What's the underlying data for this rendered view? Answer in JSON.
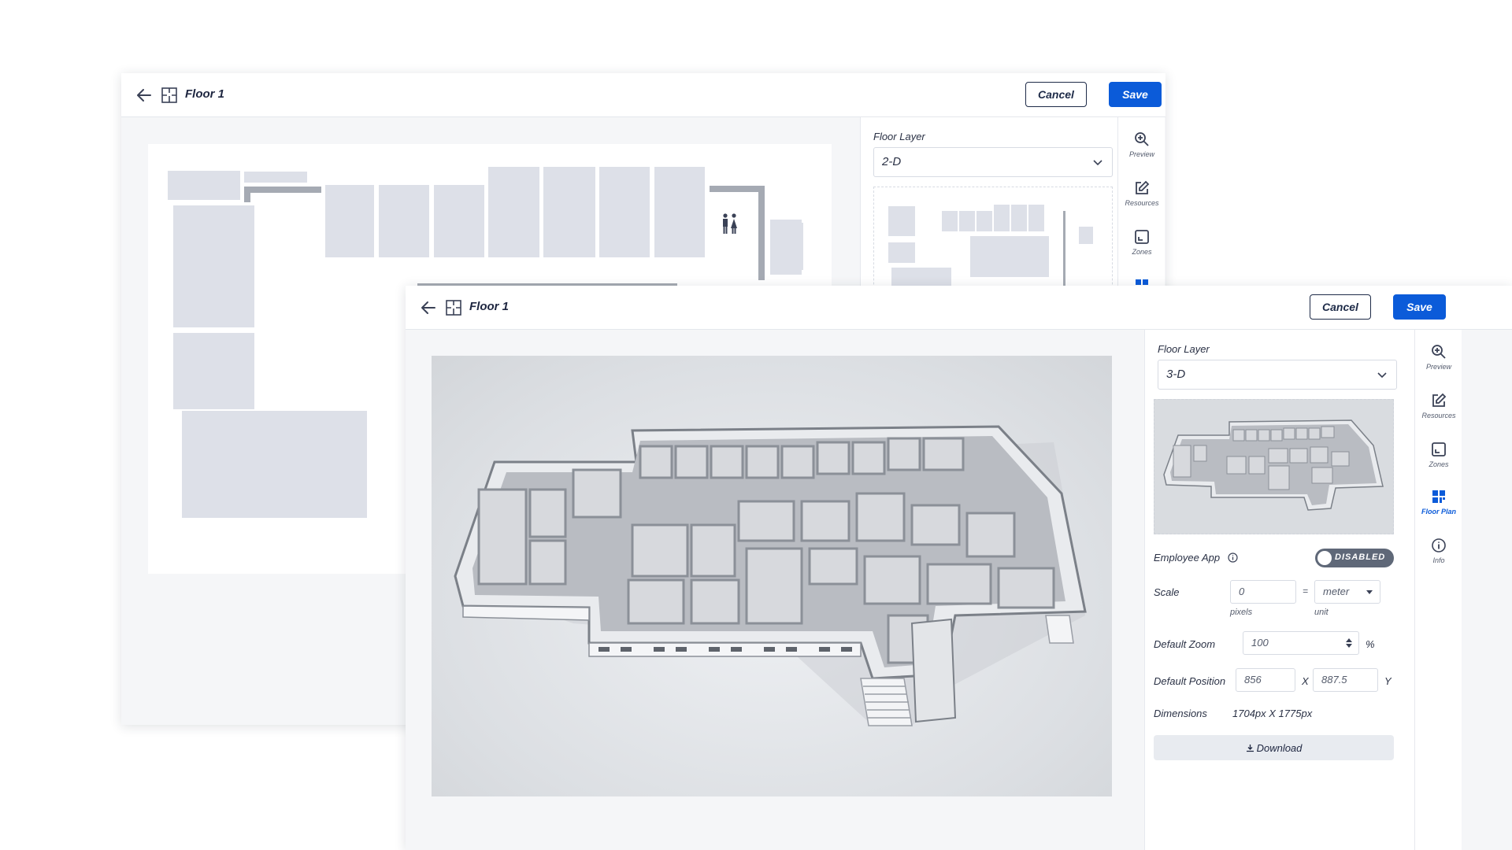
{
  "back_window": {
    "title": "Floor 1",
    "cancel_label": "Cancel",
    "save_label": "Save",
    "floor_layer_label": "Floor Layer",
    "floor_layer_value": "2-D",
    "rail": [
      {
        "label": "Preview",
        "icon": "zoom-in-icon"
      },
      {
        "label": "Resources",
        "icon": "edit-icon"
      },
      {
        "label": "Zones",
        "icon": "zones-icon"
      }
    ]
  },
  "front_window": {
    "title": "Floor 1",
    "cancel_label": "Cancel",
    "save_label": "Save",
    "floor_layer_label": "Floor Layer",
    "floor_layer_value": "3-D",
    "employee_app_label": "Employee App",
    "employee_app_state": "DISABLED",
    "scale_label": "Scale",
    "scale_value": "0",
    "scale_equals": "=",
    "scale_unit_value": "meter",
    "scale_pixels_caption": "pixels",
    "scale_unit_caption": "unit",
    "default_zoom_label": "Default Zoom",
    "default_zoom_value": "100",
    "default_zoom_unit": "%",
    "default_position_label": "Default Position",
    "position_x_value": "856",
    "position_x_label": "X",
    "position_y_value": "887.5",
    "position_y_label": "Y",
    "dimensions_label": "Dimensions",
    "dimensions_value": "1704px X 1775px",
    "download_label": "Download",
    "rail": [
      {
        "label": "Preview",
        "icon": "zoom-in-icon"
      },
      {
        "label": "Resources",
        "icon": "edit-icon"
      },
      {
        "label": "Zones",
        "icon": "zones-icon"
      },
      {
        "label": "Floor Plan",
        "icon": "floor-plan-icon",
        "active": true
      },
      {
        "label": "Info",
        "icon": "info-icon"
      }
    ]
  },
  "colors": {
    "accent": "#0b5bd9",
    "header_text": "#1e2640",
    "toggle_disabled": "#5f6878"
  }
}
